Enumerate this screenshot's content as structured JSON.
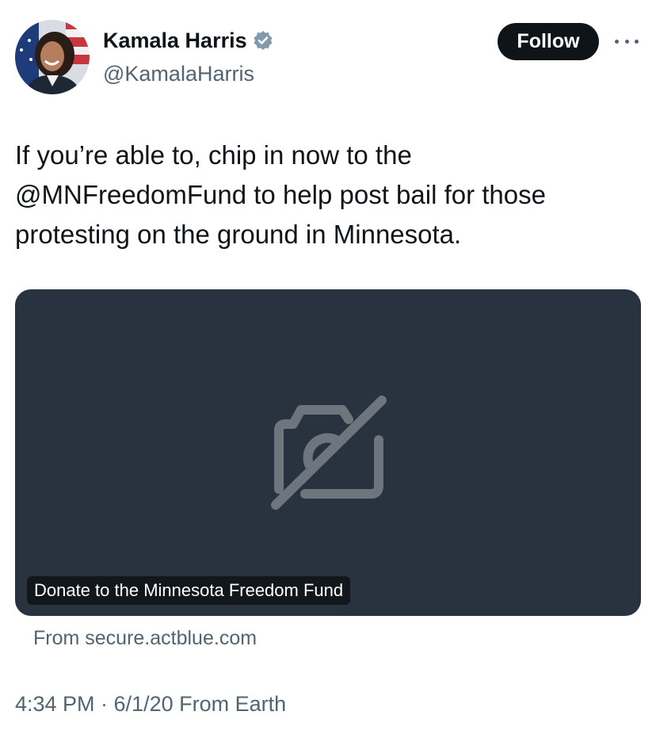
{
  "author": {
    "display_name": "Kamala Harris",
    "handle": "@KamalaHarris",
    "avatar_icon": "profile-photo",
    "verified_icon": "verified-badge-icon",
    "verified_color": "#829aab"
  },
  "actions": {
    "follow_label": "Follow",
    "more_icon": "more-options-icon"
  },
  "tweet": {
    "text": "If you’re able to, chip in now to the\n@MNFreedomFund to help post bail for those\nprotesting on the ground in Minnesota."
  },
  "link_card": {
    "placeholder_icon": "broken-image-icon",
    "title": "Donate to the Minnesota Freedom Fund",
    "source": "From secure.actblue.com",
    "background_color": "#29333f"
  },
  "meta": {
    "timestamp": "4:34 PM · 6/1/20 From Earth"
  },
  "colors": {
    "text_primary": "#0f1419",
    "text_secondary": "#536471",
    "follow_button": "#0f1419"
  }
}
